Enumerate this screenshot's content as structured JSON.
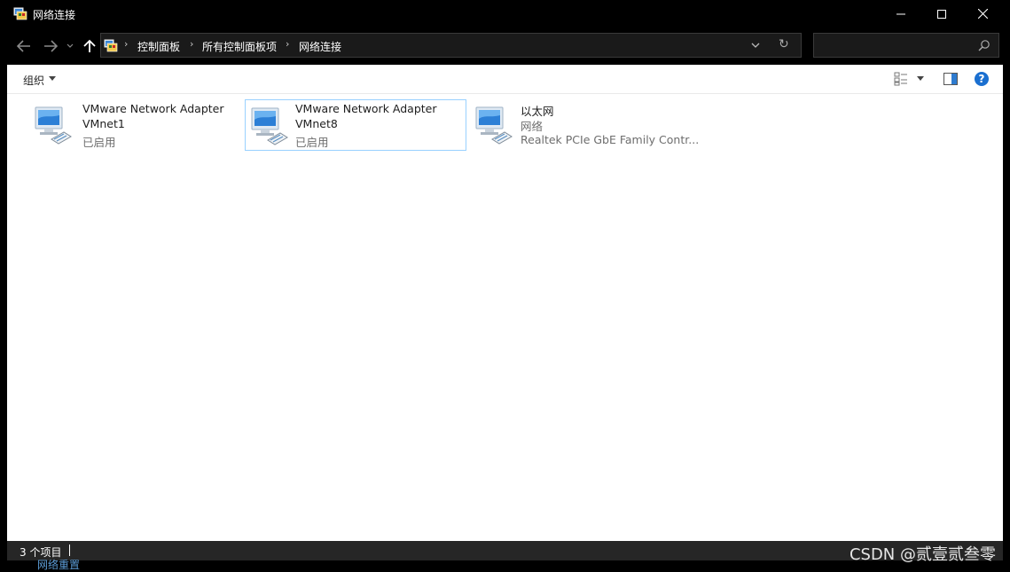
{
  "window": {
    "title": "网络连接",
    "controls": {
      "minimize": "minimize",
      "maximize": "maximize",
      "close": "close"
    }
  },
  "address_bar": {
    "breadcrumbs": [
      "控制面板",
      "所有控制面板项",
      "网络连接"
    ],
    "separator": "›"
  },
  "search": {
    "placeholder": ""
  },
  "toolbar": {
    "organize_label": "组织"
  },
  "items": [
    {
      "line1": "VMware Network Adapter",
      "line2": "VMnet1",
      "line3": "已启用",
      "selected": false
    },
    {
      "line1": "VMware Network Adapter",
      "line2": "VMnet8",
      "line3": "已启用",
      "selected": true
    },
    {
      "line1": "以太网",
      "line2": "网络",
      "line3": "Realtek PCIe GbE Family Contr...",
      "selected": false
    }
  ],
  "status_bar": {
    "item_count": "3 个项目"
  },
  "background_peek": "网络重置",
  "watermark": "CSDN @贰壹贰叁零",
  "colors": {
    "accent": "#1a6fd0",
    "selection_border": "#99d1ff",
    "titlebar": "#000000",
    "statusbar": "#262626"
  },
  "icons": [
    "network-connections-icon",
    "back-arrow-icon",
    "forward-arrow-icon",
    "recent-dropdown-icon",
    "up-arrow-icon",
    "control-panel-icon",
    "chevron-down-icon",
    "refresh-icon",
    "search-icon",
    "view-options-icon",
    "preview-pane-icon",
    "help-icon",
    "network-adapter-icon"
  ]
}
